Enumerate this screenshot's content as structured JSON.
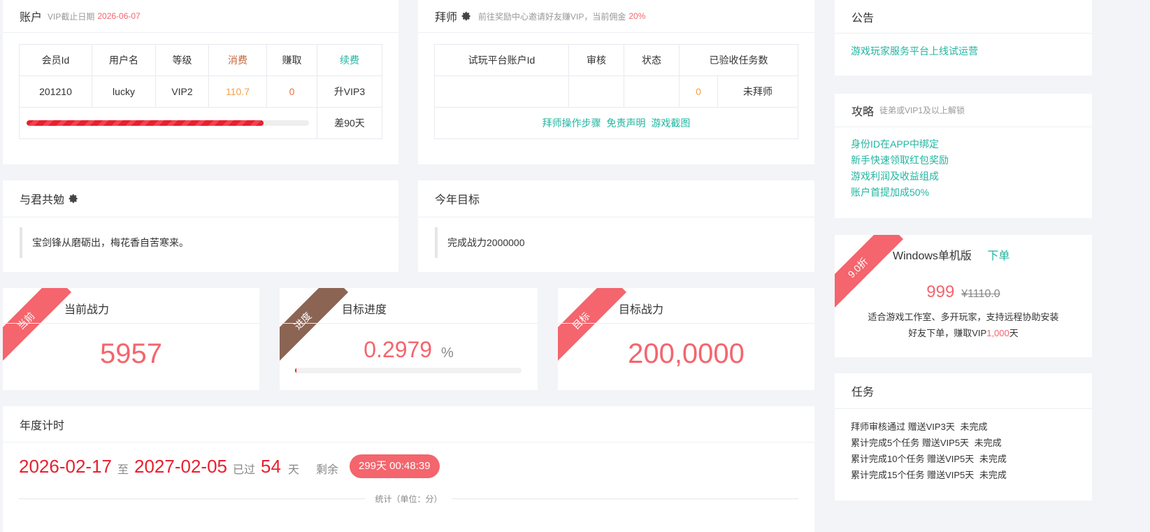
{
  "account": {
    "title": "账户",
    "vip_label": "VIP截止日期",
    "vip_date": "2026-06-07",
    "headers": [
      "会员Id",
      "用户名",
      "等级",
      "消费",
      "赚取",
      "续费"
    ],
    "member_id": "201210",
    "username": "lucky",
    "level": "VIP2",
    "spent": "110.7",
    "earned": "0",
    "upgrade": "升VIP3",
    "progress": 0.84,
    "days_left": "差90天"
  },
  "mentor": {
    "title": "拜师",
    "sub_prefix": "前往奖励中心邀请好友赚VIP，当前佣金",
    "commission": "20%",
    "headers": [
      "试玩平台账户Id",
      "审核",
      "状态",
      "已验收任务数"
    ],
    "tasks_count": "0",
    "status": "未拜师",
    "links": [
      "拜师操作步骤",
      "免责声明",
      "游戏截图"
    ]
  },
  "motto": {
    "title": "与君共勉",
    "text": "宝剑锋从磨砺出，梅花香自苦寒来。"
  },
  "goal": {
    "title": "今年目标",
    "text": "完成战力2000000"
  },
  "stats": {
    "current": {
      "ribbon": "当前",
      "title": "当前战力",
      "value": "5957"
    },
    "progress": {
      "ribbon": "进度",
      "title": "目标进度",
      "value": "0.2979",
      "unit": "%",
      "fill": 0.003
    },
    "target": {
      "ribbon": "目标",
      "title": "目标战力",
      "value": "200,0000"
    }
  },
  "yearly": {
    "title": "年度计时",
    "start": "2026-02-17",
    "to": "至",
    "end": "2027-02-05",
    "passed_label": "已过",
    "passed": "54",
    "day_unit": "天",
    "remain_label": "剩余",
    "countdown": "299天 00:48:39",
    "chart_caption": "统计（单位：分）"
  },
  "notice": {
    "title": "公告",
    "text": "游戏玩家服务平台上线试运营"
  },
  "guide": {
    "title": "攻略",
    "sub": "徒弟或VIP1及以上解锁",
    "items": [
      "身份ID在APP中绑定",
      "新手快速领取红包奖励",
      "游戏利润及收益组成",
      "账户首提加成50%"
    ]
  },
  "product": {
    "ribbon": "9.0折",
    "name": "Windows单机版",
    "order": "下单",
    "price": "999",
    "old_price": "¥1110.0",
    "desc": "适合游戏工作室、多开玩家，支持远程协助安装",
    "promo_prefix": "好友下单，赚取VIP",
    "promo_days": "1,000",
    "promo_suffix": "天"
  },
  "tasks": {
    "title": "任务",
    "items": [
      {
        "name": "拜师审核通过",
        "reward": "赠送VIP3天",
        "status": "未完成"
      },
      {
        "name": "累计完成5个任务",
        "reward": "赠送VIP5天",
        "status": "未完成"
      },
      {
        "name": "累计完成10个任务",
        "reward": "赠送VIP5天",
        "status": "未完成"
      },
      {
        "name": "累计完成15个任务",
        "reward": "赠送VIP5天",
        "status": "未完成"
      }
    ]
  },
  "colors": {
    "accent_red": "#f4656d",
    "teal": "#22b5a0",
    "brown": "#8b6454",
    "orange": "#f5a04a",
    "bar_red": "#e8202e"
  }
}
